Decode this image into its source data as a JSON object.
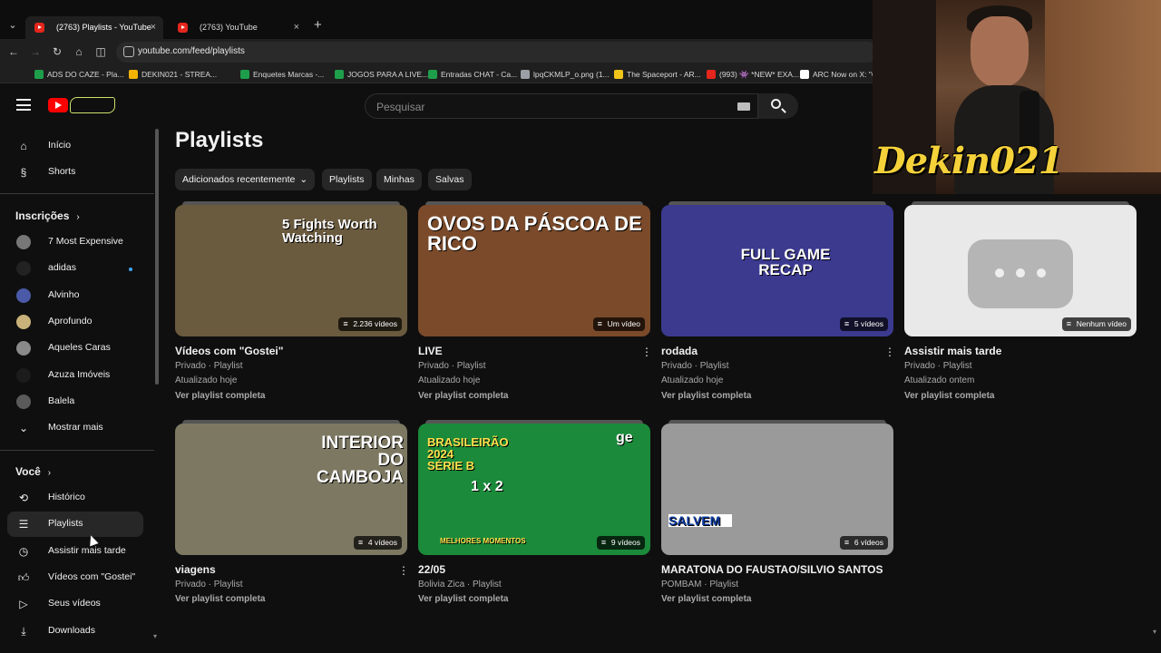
{
  "browser": {
    "tabs": [
      {
        "title": "(2763) Playlists - YouTube",
        "close": "×"
      },
      {
        "title": "(2763) YouTube",
        "close": "×"
      }
    ],
    "new_tab": "+",
    "url": "youtube.com/feed/playlists",
    "bookmarks": [
      {
        "label": "ADS DO CAZE - Pla...",
        "color": "#1e9e4a"
      },
      {
        "label": "DEKIN021 - STREA...",
        "color": "#f4b400"
      },
      {
        "label": "Enquetes Marcas -...",
        "color": "#1e9e4a"
      },
      {
        "label": "JOGOS PARA A LIVE...",
        "color": "#1e9e4a"
      },
      {
        "label": "Entradas CHAT - Ca...",
        "color": "#1e9e4a"
      },
      {
        "label": "lpqCKMLP_o.png (1...",
        "color": "#9aa0a6"
      },
      {
        "label": "The Spaceport - AR...",
        "color": "#f0c419"
      },
      {
        "label": "(993) 👾 *NEW* EXA...",
        "color": "#e4261c"
      },
      {
        "label": "ARC Now on X: \"Co...",
        "color": "#ffffff"
      }
    ]
  },
  "masthead": {
    "search_placeholder": "Pesquisar"
  },
  "sidebar": {
    "top": [
      {
        "label": "Início",
        "icon": "home-icon"
      },
      {
        "label": "Shorts",
        "icon": "shorts-icon"
      }
    ],
    "subscriptions_heading": "Inscrições",
    "subscriptions": [
      {
        "label": "7 Most Expensive",
        "color": "#777777"
      },
      {
        "label": "adidas",
        "color": "#222222",
        "new": true
      },
      {
        "label": "Alvinho",
        "color": "#4a5aa8"
      },
      {
        "label": "Aprofundo",
        "color": "#c9b27a"
      },
      {
        "label": "Aqueles Caras",
        "color": "#8a8a8a"
      },
      {
        "label": "Azuza Imóveis",
        "color": "#1c1c1c"
      },
      {
        "label": "Balela",
        "color": "#5a5a5a"
      },
      {
        "label": "Mostrar mais",
        "icon": "chevron-down-icon"
      }
    ],
    "you_heading": "Você",
    "you_items": [
      {
        "label": "Histórico",
        "icon": "history-icon"
      },
      {
        "label": "Playlists",
        "icon": "playlists-icon",
        "active": true
      },
      {
        "label": "Assistir mais tarde",
        "icon": "clock-icon"
      },
      {
        "label": "Vídeos com \"Gostei\"",
        "icon": "thumbs-up-icon"
      },
      {
        "label": "Seus vídeos",
        "icon": "your-videos-icon"
      },
      {
        "label": "Downloads",
        "icon": "download-icon"
      }
    ]
  },
  "main": {
    "title": "Playlists",
    "chips": [
      "Adicionados recentemente",
      "Playlists",
      "Minhas",
      "Salvas"
    ],
    "chip_dropdown_arrow": "⌄",
    "link_label": "Ver playlist completa",
    "playlists": [
      {
        "title": "Vídeos com \"Gostei\"",
        "meta": "Privado · Playlist",
        "updated": "Atualizado hoje",
        "count": "2.236 vídeos",
        "thumb_text": "5 Fights Worth Watching",
        "thumb_color": "#6a5a3e",
        "kebab": false
      },
      {
        "title": "LIVE",
        "meta": "Privado · Playlist",
        "updated": "Atualizado hoje",
        "count": "Um vídeo",
        "thumb_text": "OVOS DA PÁSCOA DE RICO",
        "thumb_color": "#7a4a2a",
        "kebab": true
      },
      {
        "title": "rodada",
        "meta": "Privado · Playlist",
        "updated": "Atualizado hoje",
        "count": "5 vídeos",
        "thumb_text": "FULL GAME RECAP",
        "thumb_color": "#3b3a8f",
        "kebab": true
      },
      {
        "title": "Assistir mais tarde",
        "meta": "Privado · Playlist",
        "updated": "Atualizado ontem",
        "count": "Nenhum vídeo",
        "thumb_text": "",
        "thumb_color": "#e9e9e9",
        "kebab": false
      },
      {
        "title": "viagens",
        "meta": "Privado · Playlist",
        "updated": "",
        "count": "4 vídeos",
        "thumb_text": "INTERIOR DO CAMBOJA",
        "thumb_color": "#7d7862",
        "kebab": true
      },
      {
        "title": "22/05",
        "meta": "Bolivia Zica · Playlist",
        "updated": "",
        "count": "9 vídeos",
        "thumb_text": "BRASILEIRÃO 2024 SÉRIE B",
        "thumb_extra": "ge",
        "thumb_score": "1 x 2",
        "thumb_footer": "MELHORES MOMENTOS",
        "thumb_color": "#1b8a3a",
        "kebab": false
      },
      {
        "title": "MARATONA DO FAUSTAO/SILVIO SANTOS",
        "meta": "POMBAM · Playlist",
        "updated": "",
        "count": "6 vídeos",
        "thumb_text": "SALVEM",
        "thumb_color": "#9a9a9a",
        "kebab": false
      }
    ]
  },
  "webcam": {
    "name": "Dekin021"
  }
}
